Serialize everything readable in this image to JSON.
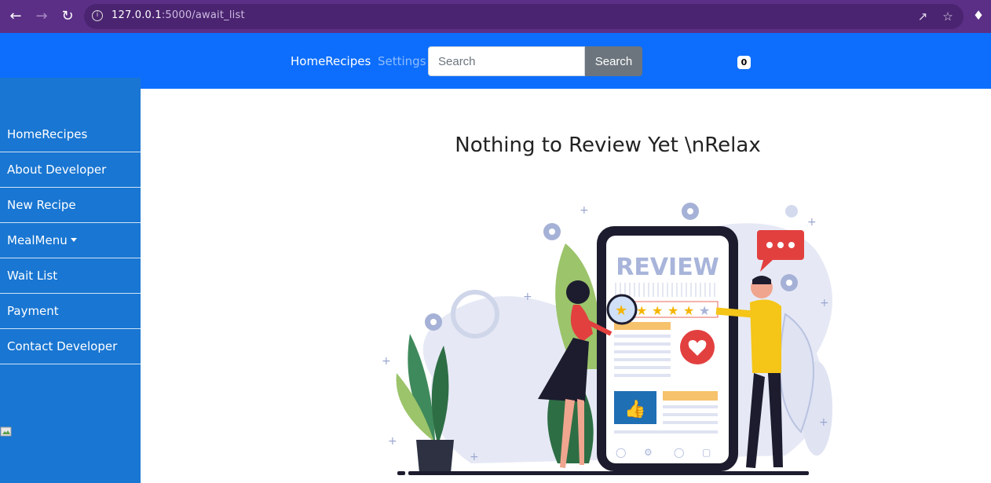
{
  "browser": {
    "url_host": "127.0.0.1",
    "url_rest": ":5000/await_list"
  },
  "navbar": {
    "home_label": "HomeRecipes",
    "settings_label": "Settings",
    "search_placeholder": "Search",
    "search_button": "Search",
    "badge_count": "0"
  },
  "sidebar": {
    "items": [
      {
        "label": "HomeRecipes"
      },
      {
        "label": "About Developer"
      },
      {
        "label": "New Recipe"
      },
      {
        "label": "MealMenu"
      },
      {
        "label": "Wait List"
      },
      {
        "label": "Payment"
      },
      {
        "label": "Contact Developer"
      }
    ]
  },
  "main": {
    "heading": "Nothing to Review Yet \\nRelax",
    "illustration": {
      "screen_title": "REVIEW"
    }
  },
  "colors": {
    "browser_frame": "#5b2f86",
    "navbar": "#0d6efd",
    "sidebar": "#1976d2",
    "search_button": "#6c757d"
  }
}
